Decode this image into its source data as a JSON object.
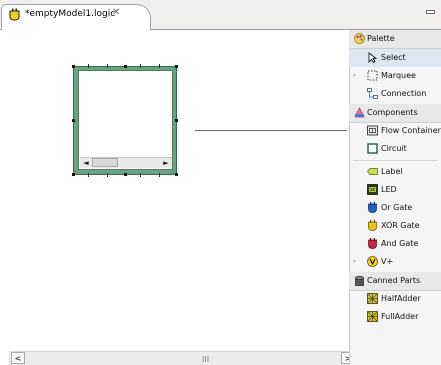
{
  "editor": {
    "tab_title": "*emptyModel1.logic",
    "tab_close": "✕",
    "tab_icon": "logic-file-icon"
  },
  "canvas": {
    "scroll_grip": "III",
    "scroll_left": "<",
    "scroll_right": ">",
    "inner_scroll_left": "◄",
    "inner_scroll_right": "►"
  },
  "palette": {
    "header": "Palette",
    "tools": [
      {
        "label": "Select",
        "icon": "arrow-pointer-icon"
      },
      {
        "label": "Marquee",
        "icon": "marquee-icon"
      },
      {
        "label": "Connection",
        "icon": "connection-icon"
      }
    ],
    "components_drawer": "Components",
    "components": [
      {
        "label": "Flow Container",
        "icon": "flow-container-icon"
      },
      {
        "label": "Circuit",
        "icon": "circuit-icon"
      },
      {
        "label": "Label",
        "icon": "label-icon"
      },
      {
        "label": "LED",
        "icon": "led-icon"
      },
      {
        "label": "Or Gate",
        "icon": "or-gate-icon"
      },
      {
        "label": "XOR Gate",
        "icon": "xor-gate-icon"
      },
      {
        "label": "And Gate",
        "icon": "and-gate-icon"
      },
      {
        "label": "V+",
        "icon": "vplus-icon"
      }
    ],
    "canned_drawer": "Canned Parts",
    "canned": [
      {
        "label": "HalfAdder",
        "icon": "half-adder-icon"
      },
      {
        "label": "FullAdder",
        "icon": "full-adder-icon"
      }
    ]
  },
  "colors": {
    "container_green": "#6aa384",
    "selection_blue": "#dde6f3",
    "or_gate_blue": "#1f5fbf",
    "xor_gate_yellow": "#e9c21a",
    "and_gate_red": "#c8283d"
  }
}
